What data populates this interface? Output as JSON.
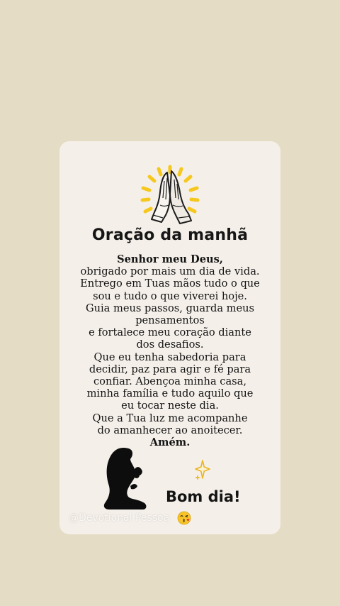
{
  "card": {
    "title": "Oração da manhã",
    "prayer_lines": [
      "Senhor meu Deus,",
      "obrigado por mais um dia de vida.",
      "Entrego em Tuas mãos tudo o que",
      "sou e tudo o que viverei hoje.",
      "Guia meus passos, guarda meus",
      "pensamentos",
      "e fortalece meu coração diante",
      "dos desafios.",
      "Que eu tenha sabedoria para",
      "decidir, paz para agir e fé para",
      "confiar. Abençoa minha casa,",
      "minha família e tudo aquilo que",
      "eu tocar neste dia.",
      "Que a Tua luz me acompanhe",
      "do amanhecer ao anoitecer.",
      "Amém."
    ],
    "greeting": "Bom dia!",
    "watermark": "@Devotional Pessoa",
    "icons": {
      "top": "praying-hands-icon",
      "left": "kneeling-person-icon",
      "sparkle": "sparkle-icon",
      "emoji": "kissing-face-emoji"
    }
  },
  "colors": {
    "background": "#e5dcc5",
    "card": "#f4efe9",
    "rays": "#f6c81e",
    "text": "#141414"
  }
}
